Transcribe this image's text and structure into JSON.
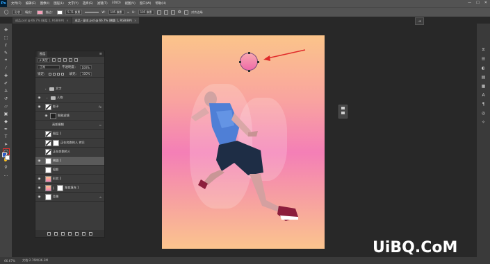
{
  "app": {
    "logo": "Ps"
  },
  "menu": [
    "文件(F)",
    "编辑(E)",
    "图像(I)",
    "图层(L)",
    "文字(Y)",
    "选择(S)",
    "滤镜(T)",
    "3D(D)",
    "视图(V)",
    "窗口(W)",
    "帮助(H)"
  ],
  "window_controls": [
    "—",
    "□",
    "✕"
  ],
  "options": {
    "shape_mode": "形状",
    "fill_label": "填充：",
    "stroke_label": "描边：",
    "stroke_width": "5.71 像素",
    "w_label": "W:",
    "w_value": "105 像素",
    "h_label": "H:",
    "h_value": "105 像素",
    "align_edges": "对齐边缘",
    "fill_color": "#f4a0b8"
  },
  "tabs": [
    {
      "label": "成品.psd @ 66.7% (图层 1, RGB/8#)",
      "active": false
    },
    {
      "label": "成品 - 副本.psd @ 66.7% (椭圆 1, RGB/8#)",
      "active": true
    }
  ],
  "layers_panel": {
    "title": "图层",
    "menu_icon": "≡",
    "filter_kind": "ρ 类型",
    "blend_mode": "正常",
    "opacity_label": "不透明度：",
    "opacity_value": "100%",
    "lock_label": "锁定：",
    "fill_label": "填充：",
    "fill_value": "100%",
    "layers": [
      {
        "name": "文字",
        "type": "group",
        "visible": false,
        "indent": 1
      },
      {
        "name": "人物",
        "type": "group",
        "visible": true,
        "indent": 1
      },
      {
        "name": "影子",
        "type": "layer",
        "visible": true,
        "indent": 0,
        "fx": "fx"
      },
      {
        "name": "智能滤镜",
        "type": "filter",
        "visible": true,
        "indent": 1
      },
      {
        "name": "高斯模糊",
        "type": "filter",
        "visible": false,
        "indent": 2
      },
      {
        "name": "图层 1",
        "type": "layer",
        "visible": false,
        "indent": 0
      },
      {
        "name": "正在奔跑的人 拷贝",
        "type": "layer",
        "visible": false,
        "indent": 0
      },
      {
        "name": "正在奔跑的人",
        "type": "layer",
        "visible": false,
        "indent": 0
      },
      {
        "name": "椭圆 1",
        "type": "shape",
        "visible": true,
        "indent": 0,
        "selected": true
      },
      {
        "name": "投影",
        "type": "layer",
        "visible": false,
        "indent": 0
      },
      {
        "name": "形状 2",
        "type": "layer",
        "visible": true,
        "indent": 0
      },
      {
        "name": "渐变填充 1",
        "type": "fill",
        "visible": true,
        "indent": 0
      },
      {
        "name": "背景",
        "type": "background",
        "visible": true,
        "indent": 0
      }
    ]
  },
  "status": {
    "zoom": "66.67%",
    "doc": "文档:2.76M/36.2M"
  },
  "watermark": "UiBQ.CoM",
  "colors": {
    "foreground": "#2f5cc9",
    "background": "#ffffff",
    "canvas_top": "#fbc48a",
    "canvas_mid": "#f47fb6",
    "highlight": "#e23030"
  },
  "toolbar_icons": [
    "move-icon",
    "marquee-icon",
    "lasso-icon",
    "quick-select-icon",
    "crop-icon",
    "eyedropper-icon",
    "healing-icon",
    "brush-icon",
    "stamp-icon",
    "history-brush-icon",
    "eraser-icon",
    "gradient-icon",
    "blur-icon",
    "dodge-icon",
    "pen-icon",
    "text-icon",
    "path-select-icon",
    "ellipse-tool-icon",
    "hand-icon",
    "zoom-icon"
  ]
}
